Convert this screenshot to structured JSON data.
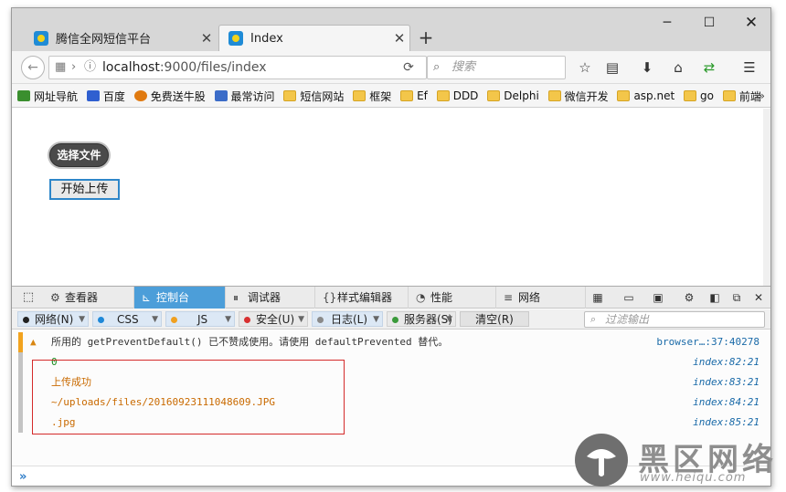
{
  "tabs": [
    {
      "title": "腾信全网短信平台"
    },
    {
      "title": "Index"
    }
  ],
  "window_controls": {
    "minimize": "─",
    "maximize": "☐",
    "close": "✕"
  },
  "navbar": {
    "url_host": "localhost",
    "url_rest": ":9000/files/index",
    "search_placeholder": "搜索"
  },
  "bookmarks": [
    {
      "label": "网址导航",
      "icon": "nav-site-icon",
      "color": "#3a8f2e"
    },
    {
      "label": "百度",
      "icon": "baidu-icon",
      "color": "#2f5fd0"
    },
    {
      "label": "免费送牛股",
      "icon": "stock-icon",
      "color": "#e07a10"
    },
    {
      "label": "最常访问",
      "icon": "most-visited-icon",
      "color": "#3b6cc8"
    },
    {
      "label": "短信网站",
      "icon": "folder-icon",
      "color": "#f3c64a"
    },
    {
      "label": "框架",
      "icon": "folder-icon",
      "color": "#f3c64a"
    },
    {
      "label": "Ef",
      "icon": "folder-icon",
      "color": "#f3c64a"
    },
    {
      "label": "DDD",
      "icon": "folder-icon",
      "color": "#f3c64a"
    },
    {
      "label": "Delphi",
      "icon": "folder-icon",
      "color": "#f3c64a"
    },
    {
      "label": "微信开发",
      "icon": "folder-icon",
      "color": "#f3c64a"
    },
    {
      "label": "asp.net",
      "icon": "folder-icon",
      "color": "#f3c64a"
    },
    {
      "label": "go",
      "icon": "folder-icon",
      "color": "#f3c64a"
    },
    {
      "label": "前端",
      "icon": "folder-icon",
      "color": "#f3c64a"
    }
  ],
  "page": {
    "choose_file_label": "选择文件",
    "start_upload_label": "开始上传"
  },
  "devtools": {
    "tabs": [
      "查看器",
      "控制台",
      "调试器",
      "样式编辑器",
      "性能",
      "网络"
    ],
    "active_tab": "控制台",
    "filters": [
      {
        "label": "网络(N)",
        "color": "#222222"
      },
      {
        "label": "CSS",
        "color": "#1e88d8"
      },
      {
        "label": "JS",
        "color": "#f0a020"
      },
      {
        "label": "安全(U)",
        "color": "#d83030"
      },
      {
        "label": "日志(L)",
        "color": "#8a8a8a"
      },
      {
        "label": "服务器(S)",
        "color": "#3a9a3a"
      }
    ],
    "clear_label": "清空(R)",
    "filter_placeholder": "过滤输出",
    "console": {
      "warning": {
        "message": "所用的 getPreventDefault() 已不赞成使用。请使用 defaultPrevented 替代。",
        "source": "browser…:37:40278"
      },
      "logs": [
        {
          "message": "0",
          "source": "index:82:21"
        },
        {
          "message": "上传成功",
          "source": "index:83:21"
        },
        {
          "message": "~/uploads/files/20160923111048609.JPG",
          "source": "index:84:21"
        },
        {
          "message": ".jpg",
          "source": "index:85:21"
        }
      ],
      "prompt": "»"
    }
  },
  "watermark": {
    "text": "黑区网络",
    "url": "www.heiqu.com"
  }
}
